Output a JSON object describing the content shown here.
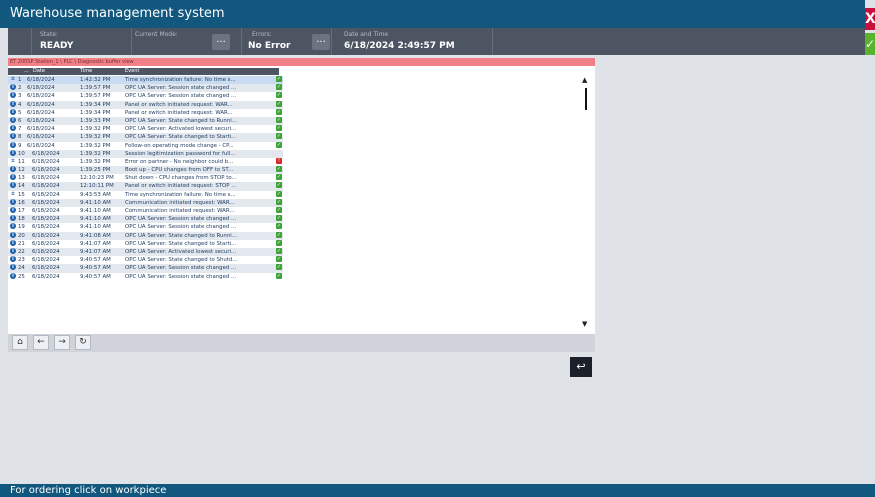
{
  "title": "Warehouse management system",
  "close_label": "X",
  "ok_label": "✓",
  "status": {
    "state_label": "State:",
    "state_value": "READY",
    "mode_label": "Current Mode:",
    "mode_value": "",
    "errors_label": "Errors:",
    "errors_value": "No Error",
    "datetime_label": "Date and Time",
    "datetime_value": "6/18/2024 2:49:57 PM",
    "more_label": "..."
  },
  "buffer_view": {
    "title": "ET 200SP Station_1 \\ PLC \\ Diagnostic buffer view",
    "columns": {
      "col0": "...",
      "date": "Date",
      "time": "Time",
      "event": "Event"
    },
    "rows": [
      {
        "no": "1",
        "date": "6/18/2024",
        "time": "1:42:32 PM",
        "event": "Time synchronization failure: No time s...",
        "icon": "sync",
        "status": "ok"
      },
      {
        "no": "2",
        "date": "6/18/2024",
        "time": "1:39:57 PM",
        "event": "OPC UA Server: Session state changed ...",
        "icon": "info",
        "status": "ok"
      },
      {
        "no": "3",
        "date": "6/18/2024",
        "time": "1:39:57 PM",
        "event": "OPC UA Server: Session state changed ...",
        "icon": "info",
        "status": "ok"
      },
      {
        "no": "4",
        "date": "6/18/2024",
        "time": "1:39:34 PM",
        "event": "Panel or switch initiated request: WAR...",
        "icon": "info",
        "status": "ok"
      },
      {
        "no": "5",
        "date": "6/18/2024",
        "time": "1:39:34 PM",
        "event": "Panel or switch initiated request: WAR...",
        "icon": "info",
        "status": "ok"
      },
      {
        "no": "6",
        "date": "6/18/2024",
        "time": "1:39:33 PM",
        "event": "OPC UA Server: State changed to Runni...",
        "icon": "info",
        "status": "ok"
      },
      {
        "no": "7",
        "date": "6/18/2024",
        "time": "1:39:32 PM",
        "event": "OPC UA Server: Activated lowest securi...",
        "icon": "info",
        "status": "ok"
      },
      {
        "no": "8",
        "date": "6/18/2024",
        "time": "1:39:32 PM",
        "event": "OPC UA Server: State changed to Starti...",
        "icon": "info",
        "status": "ok"
      },
      {
        "no": "9",
        "date": "6/18/2024",
        "time": "1:39:32 PM",
        "event": "Follow-on operating mode change - CP...",
        "icon": "info",
        "status": "ok"
      },
      {
        "no": "10",
        "date": "6/18/2024",
        "time": "1:39:32 PM",
        "event": "Session legitimization password for full...",
        "icon": "info",
        "status": ""
      },
      {
        "no": "11",
        "date": "6/18/2024",
        "time": "1:39:32 PM",
        "event": "Error on partner - No neighbor could b...",
        "icon": "sync",
        "status": "err"
      },
      {
        "no": "12",
        "date": "6/18/2024",
        "time": "1:39:25 PM",
        "event": "Boot up - CPU changes from OFF to ST...",
        "icon": "info",
        "status": "ok"
      },
      {
        "no": "13",
        "date": "6/18/2024",
        "time": "12:10:23 PM",
        "event": "Shut down - CPU changes from STOP to...",
        "icon": "info",
        "status": "ok"
      },
      {
        "no": "14",
        "date": "6/18/2024",
        "time": "12:10:11 PM",
        "event": "Panel or switch initiated request: STOP ...",
        "icon": "info",
        "status": "ok"
      },
      {
        "no": "15",
        "date": "6/18/2024",
        "time": "9:43:53 AM",
        "event": "Time synchronization failure: No time s...",
        "icon": "sync",
        "status": "ok"
      },
      {
        "no": "16",
        "date": "6/18/2024",
        "time": "9:41:10 AM",
        "event": "Communication initiated request: WAR...",
        "icon": "info",
        "status": "ok"
      },
      {
        "no": "17",
        "date": "6/18/2024",
        "time": "9:41:10 AM",
        "event": "Communication initiated request: WAR...",
        "icon": "info",
        "status": "ok"
      },
      {
        "no": "18",
        "date": "6/18/2024",
        "time": "9:41:10 AM",
        "event": "OPC UA Server: Session state changed ...",
        "icon": "info",
        "status": "ok"
      },
      {
        "no": "19",
        "date": "6/18/2024",
        "time": "9:41:10 AM",
        "event": "OPC UA Server: Session state changed ...",
        "icon": "info",
        "status": "ok"
      },
      {
        "no": "20",
        "date": "6/18/2024",
        "time": "9:41:08 AM",
        "event": "OPC UA Server: State changed to Runni...",
        "icon": "info",
        "status": "ok"
      },
      {
        "no": "21",
        "date": "6/18/2024",
        "time": "9:41:07 AM",
        "event": "OPC UA Server: State changed to Starti...",
        "icon": "info",
        "status": "ok"
      },
      {
        "no": "22",
        "date": "6/18/2024",
        "time": "9:41:07 AM",
        "event": "OPC UA Server: Activated lowest securi...",
        "icon": "info",
        "status": "ok"
      },
      {
        "no": "23",
        "date": "6/18/2024",
        "time": "9:40:57 AM",
        "event": "OPC UA Server: State changed to Shutd...",
        "icon": "info",
        "status": "ok"
      },
      {
        "no": "24",
        "date": "6/18/2024",
        "time": "9:40:57 AM",
        "event": "OPC UA Server: Session state changed ...",
        "icon": "info",
        "status": "ok"
      },
      {
        "no": "25",
        "date": "6/18/2024",
        "time": "9:40:57 AM",
        "event": "OPC UA Server: Session state changed ...",
        "icon": "info",
        "status": "ok"
      }
    ]
  },
  "toolbar": {
    "home_icon": "home-icon",
    "prev_icon": "arrow-left-icon",
    "next_icon": "arrow-right-icon",
    "refresh_icon": "refresh-icon"
  },
  "footer": "For ordering click on workpiece",
  "colors": {
    "header": "#11577e",
    "status_bar": "#4d5563",
    "pane_title": "#f28088",
    "close": "#c8103c",
    "ok": "#5ab32f"
  }
}
